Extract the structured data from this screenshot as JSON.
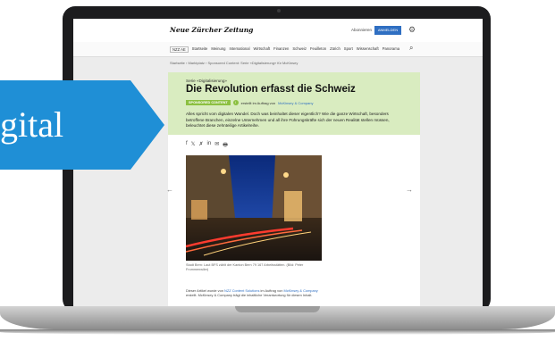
{
  "banner": {
    "text": "gital",
    "color": "#1f8fd6"
  },
  "header": {
    "logo": "Neue Zürcher Zeitung",
    "subscribe": "Abonnieren",
    "login_button": "ANMELDEN",
    "settings_icon": "gear-icon",
    "search_icon": "search-icon"
  },
  "nav": {
    "items": [
      "NZZ AE",
      "Startseite",
      "Meinung",
      "International",
      "Wirtschaft",
      "Finanzen",
      "Schweiz",
      "Feuilleton",
      "Zürich",
      "Sport",
      "Wissenschaft",
      "Panorama"
    ]
  },
  "breadcrumb": "Startseite  ›  Marktplatz  ›  Sponsored Content: Serie «Digitalisierung» für McKinsey",
  "article": {
    "series": "Serie «Digitalisierung»",
    "headline": "Die Revolution erfasst die Schweiz",
    "sponsor_badge": "SPONSORED CONTENT",
    "sponsor_prefix": "erstellt im Auftrag von",
    "sponsor_name": "McKinsey & Company",
    "lead": "Alles spricht vom digitalen Wandel. Doch was beinhaltet dieser eigentlich? Wie die ganze Wirtschaft, besonders betroffene Branchen, einzelne Unternehmen und all ihre Führungskräfte sich der neuen Realität stellen müssen, beleuchtet diese zehnteilige Artikelreihe.",
    "share_icons": [
      "f",
      "𝕏",
      "✗",
      "in",
      "✉",
      "🖶"
    ],
    "caption": "Stadt Bern: Laut BFS zählt der Kanton Bern 79 167 Arbeitsstätten. (Bild: Peter Frommenwiler)",
    "body_prefix": "Dieser Artikel wurde von",
    "body_link1": "NZZ Content Solutions",
    "body_mid": "im Auftrag von",
    "body_link2": "McKinsey & Company",
    "body_suffix": "erstellt. McKinsey & Company trägt die inhaltliche Verantwortung für diesen Inhalt."
  },
  "colors": {
    "hero_bg": "#d9ecc0",
    "badge": "#8cc041",
    "login": "#2f6fc2"
  }
}
